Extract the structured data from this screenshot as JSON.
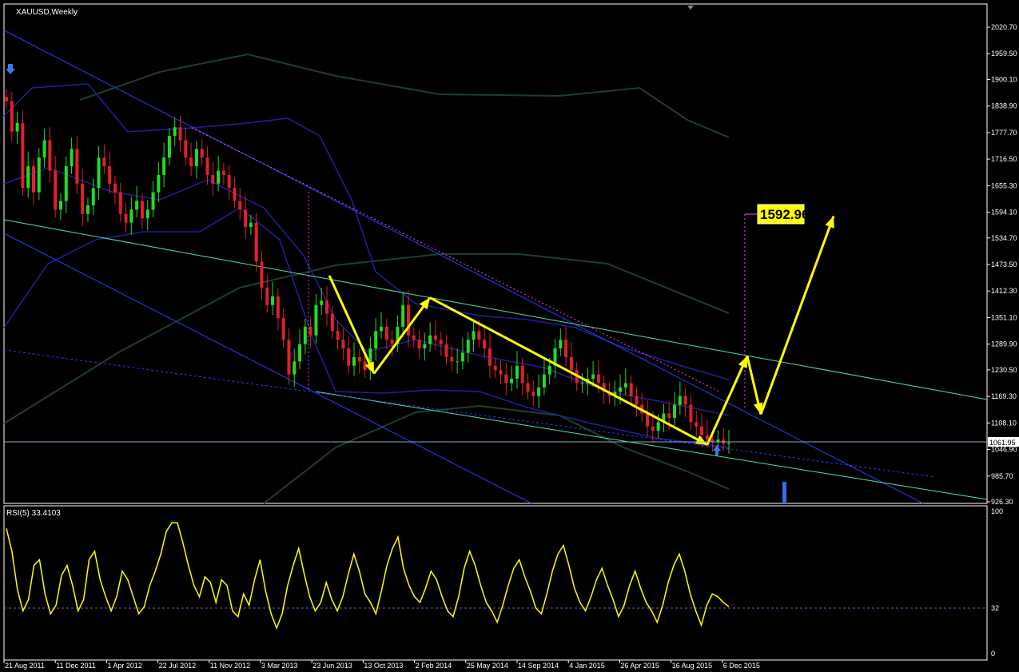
{
  "window": {
    "symbol_title": "XAUUSD,Weekly",
    "indicator_title": "RSI(5) 33.4103"
  },
  "colors": {
    "background": "#000000",
    "grid": "#ffffff",
    "bull_candle": "#22dd22",
    "bear_candle": "#e0202a",
    "channel_lines": "#2b3bff",
    "trend_lines": "#55e0a8",
    "bollinger": "#2020a0",
    "envelope": "#1f3f2a",
    "pattern": "#ffff00",
    "rsi_line": "#ffff00",
    "target_box": "#ffff00",
    "dotted_resistance": "#ff44ff"
  },
  "chart_data": [
    {
      "type": "candlestick",
      "title": "XAUUSD,Weekly",
      "price_axis_labels": [
        "2020.70",
        "1959.50",
        "1900.10",
        "1838.90",
        "1777.70",
        "1716.50",
        "1655.30",
        "1594.10",
        "1534.70",
        "1473.50",
        "1412.30",
        "1351.10",
        "1289.90",
        "1230.50",
        "1169.30",
        "1108.10",
        "1046.90",
        "985.70",
        "926.30"
      ],
      "ylim": [
        926.3,
        2020.7
      ],
      "time_axis_labels": [
        "21 Aug 2011",
        "11 Dec 2011",
        "1 Apr 2012",
        "22 Jul 2012",
        "11 Nov 2012",
        "3 Mar 2013",
        "23 Jun 2013",
        "13 Oct 2013",
        "2 Feb 2014",
        "25 May 2014",
        "14 Sep 2014",
        "4 Jan 2015",
        "26 Apr 2015",
        "16 Aug 2015",
        "6 Dec 2015"
      ],
      "current_price": "1061.95",
      "target_label": "1592.96",
      "close_series_weekly": [
        1850,
        1780,
        1800,
        1650,
        1700,
        1640,
        1720,
        1760,
        1690,
        1600,
        1620,
        1700,
        1740,
        1660,
        1590,
        1610,
        1650,
        1720,
        1700,
        1660,
        1640,
        1590,
        1570,
        1600,
        1620,
        1580,
        1600,
        1640,
        1680,
        1720,
        1770,
        1790,
        1760,
        1720,
        1700,
        1740,
        1720,
        1680,
        1660,
        1690,
        1680,
        1650,
        1620,
        1600,
        1560,
        1570,
        1480,
        1420,
        1380,
        1400,
        1350,
        1300,
        1220,
        1250,
        1290,
        1330,
        1310,
        1380,
        1390,
        1360,
        1320,
        1300,
        1280,
        1240,
        1260,
        1250,
        1230,
        1280,
        1320,
        1330,
        1300,
        1290,
        1330,
        1380,
        1310,
        1300,
        1280,
        1290,
        1310,
        1300,
        1290,
        1260,
        1250,
        1250,
        1270,
        1300,
        1320,
        1300,
        1280,
        1240,
        1230,
        1220,
        1200,
        1210,
        1240,
        1200,
        1180,
        1170,
        1190,
        1220,
        1240,
        1280,
        1300,
        1260,
        1230,
        1200,
        1200,
        1210,
        1220,
        1200,
        1180,
        1170,
        1180,
        1190,
        1200,
        1170,
        1150,
        1130,
        1100,
        1090,
        1110,
        1130,
        1120,
        1150,
        1170,
        1150,
        1110,
        1100,
        1080,
        1070,
        1065,
        1070,
        1060,
        1061.95
      ],
      "pattern_points": [
        [
          0,
          1448
        ],
        [
          0,
          1222
        ],
        [
          0,
          1397
        ],
        [
          0,
          1058
        ],
        [
          0,
          1262
        ],
        [
          0,
          1128
        ],
        [
          0,
          1585
        ]
      ],
      "rsi": {
        "name": "RSI(5)",
        "value_label": "33.4103",
        "levels": [
          "100",
          "32",
          "0"
        ],
        "ylim": [
          0,
          100
        ],
        "values": [
          88,
          72,
          45,
          30,
          38,
          62,
          66,
          42,
          28,
          34,
          55,
          62,
          48,
          30,
          38,
          66,
          72,
          52,
          40,
          30,
          40,
          58,
          52,
          40,
          28,
          33,
          48,
          58,
          70,
          86,
          92,
          92,
          78,
          62,
          48,
          40,
          54,
          50,
          36,
          52,
          48,
          30,
          26,
          42,
          34,
          52,
          66,
          44,
          28,
          18,
          28,
          48,
          62,
          74,
          56,
          40,
          30,
          36,
          50,
          38,
          30,
          40,
          56,
          70,
          58,
          42,
          36,
          28,
          44,
          62,
          74,
          82,
          60,
          48,
          40,
          36,
          46,
          58,
          52,
          40,
          30,
          26,
          40,
          60,
          72,
          62,
          48,
          36,
          30,
          22,
          34,
          48,
          60,
          66,
          54,
          44,
          32,
          28,
          42,
          58,
          70,
          76,
          62,
          46,
          36,
          30,
          40,
          52,
          60,
          48,
          38,
          26,
          34,
          48,
          58,
          46,
          36,
          30,
          22,
          34,
          50,
          62,
          70,
          58,
          42,
          30,
          20,
          34,
          42,
          40,
          36,
          33
        ]
      },
      "grid": false,
      "legend": "none"
    }
  ]
}
